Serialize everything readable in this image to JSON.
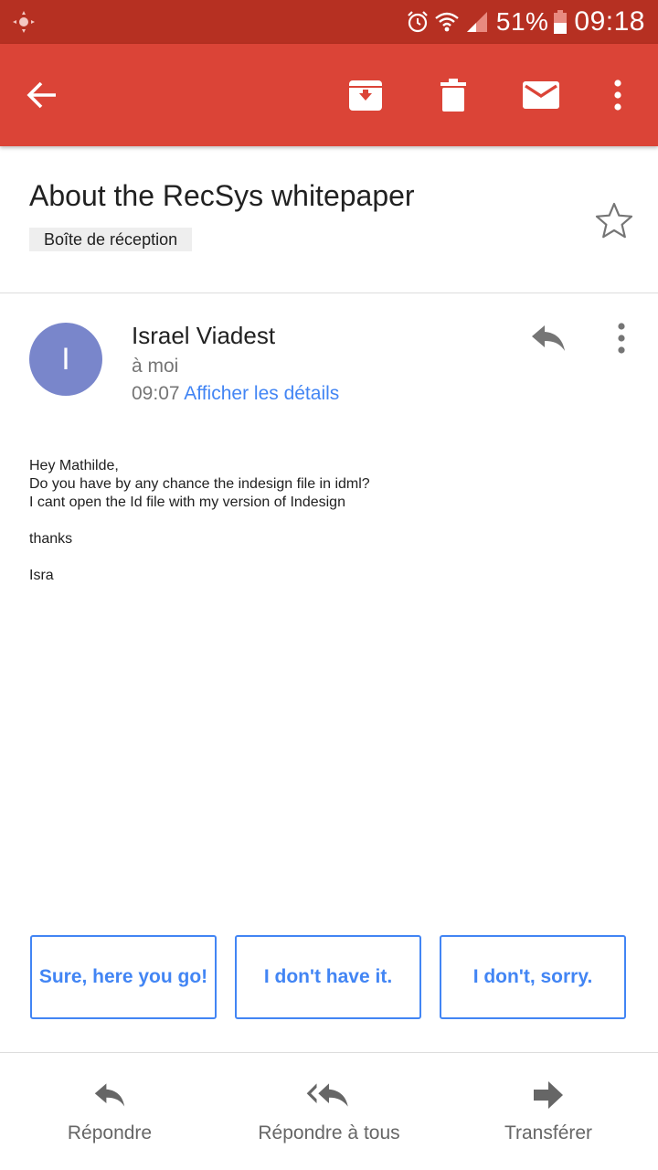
{
  "status_bar": {
    "battery_percent": "51%",
    "time": "09:18",
    "icons": [
      "location-icon",
      "alarm-icon",
      "wifi-icon",
      "signal-icon",
      "battery-icon"
    ]
  },
  "app_bar": {
    "color": "#db4437",
    "actions": [
      "back-arrow-icon",
      "archive-icon",
      "delete-icon",
      "mark-unread-icon",
      "more-vert-icon"
    ]
  },
  "email": {
    "subject": "About the RecSys whitepaper",
    "label": "Boîte de réception",
    "sender": {
      "initial": "I",
      "name": "Israel Viadest",
      "recipient": "à moi",
      "time": "09:07",
      "details_link": "Afficher les détails",
      "avatar_color": "#7986cb"
    },
    "body": {
      "greeting": "Hey Mathilde,",
      "line1": "Do you have by any chance the indesign file in idml?",
      "line2": "I cant open the Id file with my version of Indesign",
      "thanks": "thanks",
      "signature": "Isra"
    }
  },
  "smart_replies": [
    {
      "label": "Sure, here you go!"
    },
    {
      "label": "I don't have it."
    },
    {
      "label": "I don't, sorry."
    }
  ],
  "bottom_actions": {
    "reply": "Répondre",
    "reply_all": "Répondre à tous",
    "forward": "Transférer"
  },
  "colors": {
    "status_bar": "#b63022",
    "accent": "#4285f4",
    "secondary_text": "#757575"
  }
}
